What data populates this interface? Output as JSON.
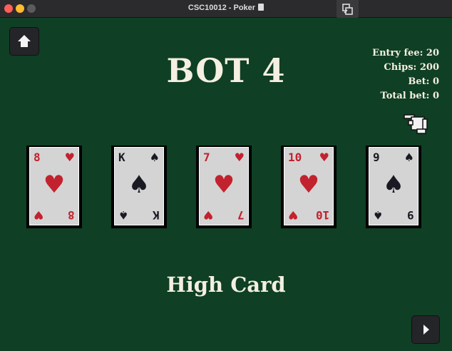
{
  "window": {
    "title": "CSC10012 - Poker"
  },
  "game": {
    "player_title": "BOT 4",
    "stats": {
      "entry_fee": "Entry fee: 20",
      "chips": "Chips: 200",
      "bet": "Bet: 0",
      "total_bet": "Total bet: 0"
    },
    "cards": [
      {
        "rank": "8",
        "suit": "♥",
        "suit_name": "hearts",
        "color": "red"
      },
      {
        "rank": "K",
        "suit": "♠",
        "suit_name": "spades",
        "color": "black"
      },
      {
        "rank": "7",
        "suit": "♥",
        "suit_name": "hearts",
        "color": "red"
      },
      {
        "rank": "10",
        "suit": "♥",
        "suit_name": "hearts",
        "color": "red"
      },
      {
        "rank": "9",
        "suit": "♠",
        "suit_name": "spades",
        "color": "black"
      }
    ],
    "hand_result": "High Card"
  },
  "icons": {
    "home": "home-icon",
    "next": "play-next-icon",
    "cursor": "pointing-hand-cursor-icon",
    "restore": "restore-window-icon"
  },
  "colors": {
    "table_felt": "#0f3f24",
    "text": "#f4efe2",
    "red_suit": "#c2222e",
    "black_suit": "#1a1a22",
    "card_face": "#d4d4d4"
  }
}
